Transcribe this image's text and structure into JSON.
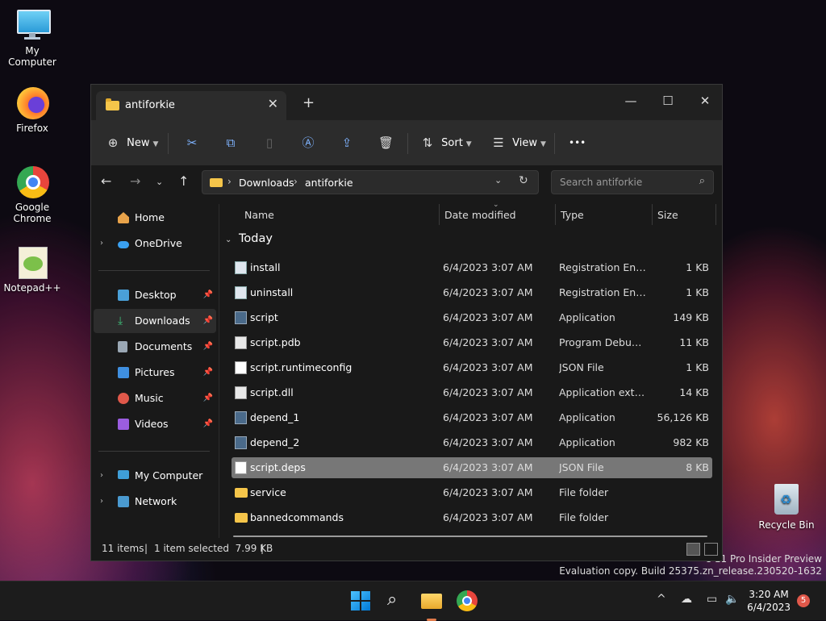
{
  "desktop": {
    "icons": [
      {
        "label": "My Computer"
      },
      {
        "label": "Firefox"
      },
      {
        "label": "Google Chrome"
      },
      {
        "label": "Notepad++"
      },
      {
        "label": "Recycle Bin"
      }
    ],
    "watermark": {
      "line1": "s 11 Pro Insider Preview",
      "line2": "Evaluation copy. Build 25375.zn_release.230520-1632"
    }
  },
  "window": {
    "tab_title": "antiforkie",
    "tab_close": "✕",
    "new_tab": "+",
    "controls": {
      "minimize": "—",
      "maximize": "☐",
      "close": "✕"
    }
  },
  "toolbar": {
    "new_label": "New",
    "sort_label": "Sort",
    "view_label": "View",
    "more_label": "•••"
  },
  "address": {
    "crumbs": [
      "Downloads",
      "antiforkie"
    ],
    "separator": "›",
    "search_placeholder": "Search antiforkie"
  },
  "sidebar": {
    "items": [
      {
        "label": "Home",
        "color": "#e8a34a"
      },
      {
        "label": "OneDrive",
        "color": "#3aa0f0"
      },
      {
        "label": "Desktop",
        "color": "#4aa0d8"
      },
      {
        "label": "Downloads",
        "color": "#3fbf7a"
      },
      {
        "label": "Documents",
        "color": "#9aa7b4"
      },
      {
        "label": "Pictures",
        "color": "#3f8fe0"
      },
      {
        "label": "Music",
        "color": "#e0584a"
      },
      {
        "label": "Videos",
        "color": "#9b5de0"
      },
      {
        "label": "My Computer",
        "color": "#3f9fd8"
      },
      {
        "label": "Network",
        "color": "#4a9ad0"
      }
    ],
    "pin": "📌",
    "expander": "›"
  },
  "columns": {
    "name": "Name",
    "date": "Date modified",
    "type": "Type",
    "size": "Size"
  },
  "group_label": "Today",
  "files": [
    {
      "name": "install",
      "date": "6/4/2023 3:07 AM",
      "type": "Registration Entries",
      "size": "1 KB"
    },
    {
      "name": "uninstall",
      "date": "6/4/2023 3:07 AM",
      "type": "Registration Entries",
      "size": "1 KB"
    },
    {
      "name": "script",
      "date": "6/4/2023 3:07 AM",
      "type": "Application",
      "size": "149 KB"
    },
    {
      "name": "script.pdb",
      "date": "6/4/2023 3:07 AM",
      "type": "Program Debug D...",
      "size": "11 KB"
    },
    {
      "name": "script.runtimeconfig",
      "date": "6/4/2023 3:07 AM",
      "type": "JSON File",
      "size": "1 KB"
    },
    {
      "name": "script.dll",
      "date": "6/4/2023 3:07 AM",
      "type": "Application exten...",
      "size": "14 KB"
    },
    {
      "name": "depend_1",
      "date": "6/4/2023 3:07 AM",
      "type": "Application",
      "size": "56,126 KB"
    },
    {
      "name": "depend_2",
      "date": "6/4/2023 3:07 AM",
      "type": "Application",
      "size": "982 KB"
    },
    {
      "name": "script.deps",
      "date": "6/4/2023 3:07 AM",
      "type": "JSON File",
      "size": "8 KB"
    },
    {
      "name": "service",
      "date": "6/4/2023 3:07 AM",
      "type": "File folder",
      "size": ""
    },
    {
      "name": "bannedcommands",
      "date": "6/4/2023 3:07 AM",
      "type": "File folder",
      "size": ""
    }
  ],
  "status": {
    "items": "11 items",
    "selected": "1 item selected  7.99 KB",
    "divider": "|"
  },
  "taskbar": {
    "time": "3:20 AM",
    "date": "6/4/2023",
    "badge": "5",
    "tray_up": "^"
  }
}
